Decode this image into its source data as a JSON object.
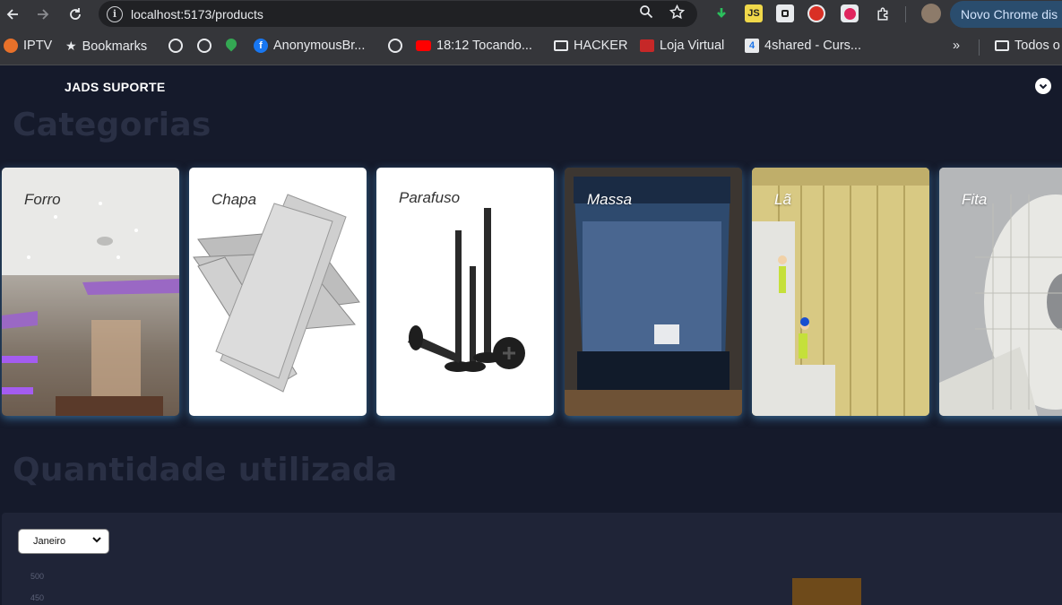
{
  "browser": {
    "url": "localhost:5173/products",
    "profile_label": "Novo Chrome dis",
    "bookmarks": [
      {
        "label": "IPTV",
        "icon": "iptv-icon"
      },
      {
        "label": "Bookmarks",
        "icon": "star-icon"
      },
      {
        "label": "",
        "icon": "globe-icon"
      },
      {
        "label": "",
        "icon": "globe-icon"
      },
      {
        "label": "",
        "icon": "maps-icon"
      },
      {
        "label": "AnonymousBr...",
        "icon": "facebook-icon"
      },
      {
        "label": "",
        "icon": "globe-icon"
      },
      {
        "label": "18:12 Tocando...",
        "icon": "youtube-icon"
      },
      {
        "label": "HACKER",
        "icon": "folder-icon"
      },
      {
        "label": "Loja Virtual",
        "icon": "store-icon"
      },
      {
        "label": "4shared - Curs...",
        "icon": "4shared-icon"
      },
      {
        "label": "Todos o",
        "icon": "folder-icon"
      }
    ]
  },
  "app": {
    "brand": "JADS SUPORTE",
    "categories_title": "Categorias",
    "categories": [
      {
        "label": "Forro"
      },
      {
        "label": "Chapa"
      },
      {
        "label": "Parafuso"
      },
      {
        "label": "Massa"
      },
      {
        "label": "Lã"
      },
      {
        "label": "Fita"
      }
    ],
    "usage_title": "Quantidade utilizada",
    "month_select": {
      "value": "Janeiro"
    },
    "chart_ticks": [
      "500",
      "450"
    ]
  },
  "colors": {
    "background": "#151a2b",
    "panel": "#1f2437",
    "title_muted": "#2a3045",
    "bar": "#6e4a1a"
  }
}
